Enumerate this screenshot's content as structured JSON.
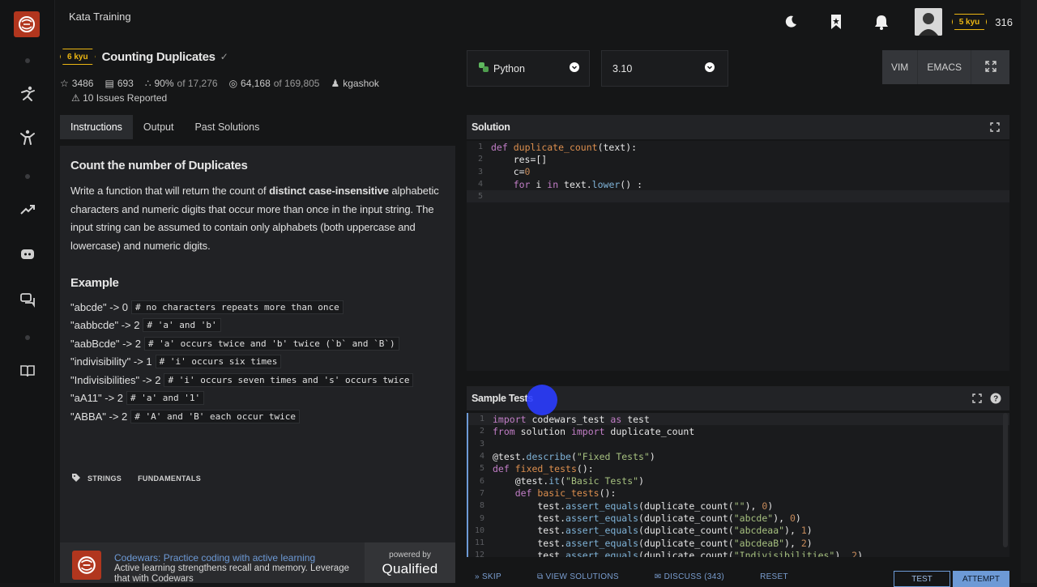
{
  "app": {
    "breadcrumb": "Kata Training"
  },
  "user": {
    "rank": "5 kyu",
    "honor": "316"
  },
  "kata": {
    "rank": "6 kyu",
    "title": "Counting Duplicates",
    "stats": {
      "stars": "3486",
      "votes": "693",
      "satisfaction_pct": "90%",
      "satisfaction_of": "of 17,276",
      "completed": "64,168",
      "completed_of": "of 169,805",
      "author": "kgashok"
    },
    "issues": "10 Issues Reported"
  },
  "tabs": [
    {
      "label": "Instructions",
      "active": true
    },
    {
      "label": "Output",
      "active": false
    },
    {
      "label": "Past Solutions",
      "active": false
    }
  ],
  "description": {
    "heading": "Count the number of Duplicates",
    "para_pre": "Write a function that will return the count of ",
    "para_bold": "distinct case-insensitive",
    "para_post": " alphabetic characters and numeric digits that occur more than once in the input string. The input string can be assumed to contain only alphabets (both uppercase and lowercase) and numeric digits.",
    "example_heading": "Example",
    "examples": [
      {
        "input": "\"abcde\" -> 0",
        "comment": "# no characters repeats more than once"
      },
      {
        "input": "\"aabbcde\" -> 2",
        "comment": "# 'a' and 'b'"
      },
      {
        "input": "\"aabBcde\" -> 2",
        "comment": "# 'a' occurs twice and 'b' twice (`b` and `B`)"
      },
      {
        "input": "\"indivisibility\" -> 1",
        "comment": "# 'i' occurs six times"
      },
      {
        "input": "\"Indivisibilities\" -> 2",
        "comment": "# 'i' occurs seven times and 's' occurs twice"
      },
      {
        "input": "\"aA11\" -> 2",
        "comment": "# 'a' and '1'"
      },
      {
        "input": "\"ABBA\" -> 2",
        "comment": "# 'A' and 'B' each occur twice"
      }
    ],
    "tags": [
      "STRINGS",
      "FUNDAMENTALS"
    ]
  },
  "promo": {
    "title": "Codewars: Practice coding with active learning",
    "subtitle": "Active learning strengthens recall and memory. Leverage that with Codewars",
    "powered_by": "powered by",
    "brand": "Qualified"
  },
  "editor": {
    "language": "Python",
    "version": "3.10",
    "modes": [
      "VIM",
      "EMACS"
    ],
    "solution_title": "Solution",
    "sample_tests_title": "Sample Tests"
  },
  "actions": {
    "skip": "SKIP",
    "view_solutions": "VIEW SOLUTIONS",
    "discuss": "DISCUSS (343)",
    "reset": "RESET",
    "test": "TEST",
    "attempt": "ATTEMPT"
  },
  "colors": {
    "accent": "#6d9ad6",
    "brand": "#b1361e",
    "kyu": "#ecb613"
  }
}
